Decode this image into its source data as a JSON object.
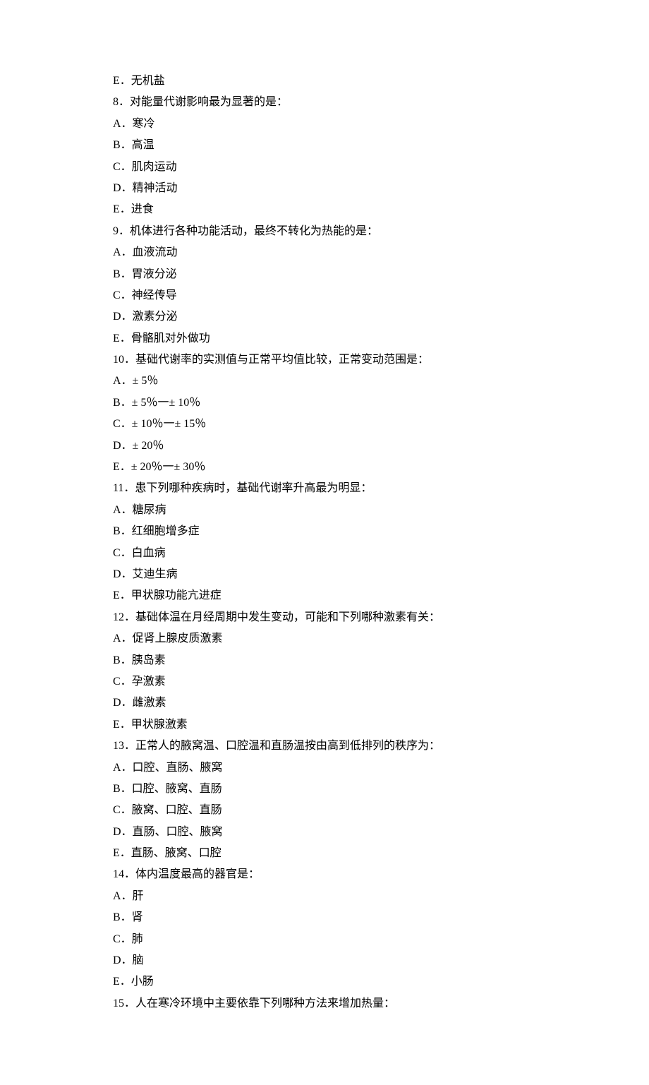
{
  "lines": [
    "E．无机盐",
    "8．对能量代谢影响最为显著的是：",
    "A．寒冷",
    "B．高温",
    "C．肌肉运动",
    "D．精神活动",
    "E．进食",
    "9．机体进行各种功能活动，最终不转化为热能的是：",
    "A．血液流动",
    "B．胃液分泌",
    "C．神经传导",
    "D．激素分泌",
    "E．骨骼肌对外做功",
    "10．基础代谢率的实测值与正常平均值比较，正常变动范围是：",
    "A．± 5％",
    "B．± 5％一± 10％",
    "C．± 10％一± 15％",
    "D．± 20％",
    "E．± 20％一± 30％",
    "11．患下列哪种疾病时，基础代谢率升高最为明显：",
    "A．糖尿病",
    "B．红细胞增多症",
    "C．白血病",
    "D．艾迪生病",
    "E．甲状腺功能亢进症",
    "12．基础体温在月经周期中发生变动，可能和下列哪种激素有关：",
    "A．促肾上腺皮质激素",
    "B．胰岛素",
    "C．孕激素",
    "D．雌激素",
    "E．甲状腺激素",
    "13．正常人的腋窝温、口腔温和直肠温按由高到低排列的秩序为：",
    "A．口腔、直肠、腋窝",
    "B．口腔、腋窝、直肠",
    "C．腋窝、口腔、直肠",
    "D．直肠、口腔、腋窝",
    "E．直肠、腋窝、口腔",
    "14．体内温度最高的器官是：",
    "A．肝",
    "B．肾",
    "C．肺",
    "D．脑",
    "E．小肠",
    "15．人在寒冷环境中主要依靠下列哪种方法来增加热量："
  ]
}
